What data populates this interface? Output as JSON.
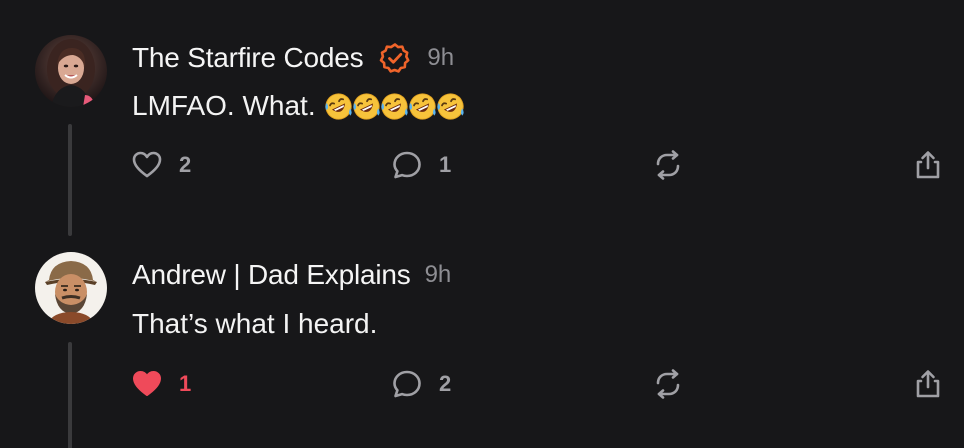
{
  "posts": [
    {
      "author": "The Starfire Codes",
      "verified": true,
      "time": "9h",
      "text": "LMFAO. What.",
      "emoji_count": 5,
      "likes": "2",
      "liked": false,
      "replies": "1",
      "icons": {
        "like": "heart-outline-icon",
        "reply": "speech-bubble-icon",
        "repost": "repost-arrows-icon",
        "share": "share-upload-icon"
      }
    },
    {
      "author": "Andrew | Dad Explains",
      "verified": false,
      "time": "9h",
      "text": "That’s what I heard.",
      "likes": "1",
      "liked": true,
      "replies": "2",
      "icons": {
        "like": "heart-filled-icon",
        "reply": "speech-bubble-icon",
        "repost": "repost-arrows-icon",
        "share": "share-upload-icon"
      }
    }
  ],
  "colors": {
    "background": "#171719",
    "verified_badge": "#f0642a",
    "liked": "#ef4a5a",
    "muted": "#8e8e93",
    "icon": "#a0a0a5"
  }
}
